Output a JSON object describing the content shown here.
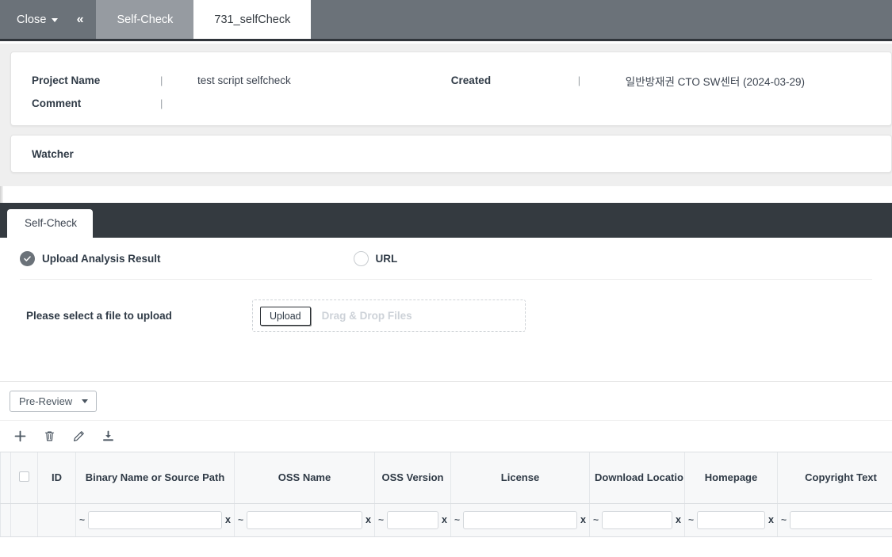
{
  "window": {
    "close_label": "Close",
    "collapse_icon": "double-chevron-left-icon",
    "tabs": [
      {
        "label": "Self-Check",
        "active": false
      },
      {
        "label": "731_selfCheck",
        "active": true
      }
    ]
  },
  "project_info": {
    "project_name_label": "Project Name",
    "project_name_value": "test script selfcheck",
    "comment_label": "Comment",
    "comment_value": "",
    "created_label": "Created",
    "created_value": "일반방재권 CTO SW센터 (2024-03-29)",
    "separator": "|",
    "watcher_label": "Watcher"
  },
  "section": {
    "tab_label": "Self-Check"
  },
  "selfcheck": {
    "option_upload_label": "Upload Analysis Result",
    "option_upload_selected": true,
    "option_url_label": "URL",
    "option_url_selected": false,
    "upload_prompt": "Please select a file to upload",
    "upload_button_label": "Upload",
    "dropzone_placeholder": "Drag & Drop Files"
  },
  "prereview": {
    "button_label": "Pre-Review"
  },
  "toolbar": {
    "icons": [
      {
        "name": "add-icon",
        "glyph": "+"
      },
      {
        "name": "delete-icon",
        "glyph": "trash"
      },
      {
        "name": "edit-icon",
        "glyph": "pencil"
      },
      {
        "name": "download-icon",
        "glyph": "download"
      }
    ]
  },
  "table": {
    "columns": [
      {
        "key": "select",
        "label": ""
      },
      {
        "key": "id",
        "label": "ID"
      },
      {
        "key": "binary",
        "label": "Binary Name or Source Path"
      },
      {
        "key": "oss_name",
        "label": "OSS Name"
      },
      {
        "key": "oss_version",
        "label": "OSS Version"
      },
      {
        "key": "license",
        "label": "License"
      },
      {
        "key": "download_location",
        "label": "Download Locatio"
      },
      {
        "key": "homepage",
        "label": "Homepage"
      },
      {
        "key": "copyright",
        "label": "Copyright Text"
      }
    ],
    "filter_row": {
      "prefix": "~",
      "clear": "x",
      "values": [
        "",
        "",
        "",
        "",
        "",
        "",
        ""
      ],
      "filterable": [
        false,
        false,
        true,
        true,
        true,
        true,
        true,
        true,
        true
      ]
    },
    "rows": []
  },
  "colors": {
    "topbar": "#6b7279",
    "topbar_border": "#2f343a",
    "inactive_tab": "#969ba1",
    "section_bar": "#343a40",
    "panel_bg": "#efefef",
    "table_header_bg": "#f7f8f9",
    "radio_selected": "#6b7279",
    "text_primary": "#2f3a46"
  }
}
